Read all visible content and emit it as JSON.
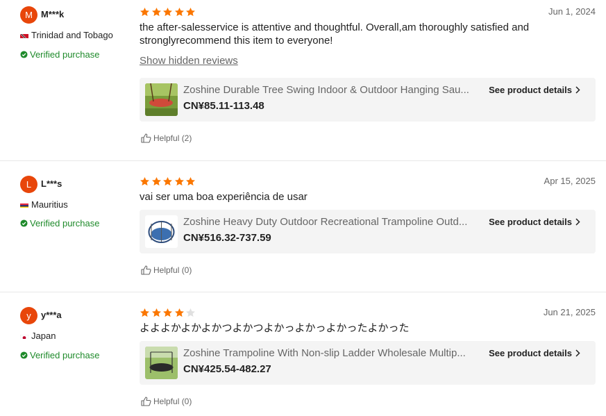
{
  "reviews": [
    {
      "avatar_letter": "M",
      "username": "M***k",
      "country": "Trinidad and Tobago",
      "verified_label": "Verified purchase",
      "rating": 5,
      "date": "Jun 1, 2024",
      "text": "the after-salesservice is attentive and thoughtful. Overall,am thoroughly satisfied and stronglyrecommend this item to everyone!",
      "show_hidden_label": "Show hidden reviews",
      "product": {
        "title": "Zoshine Durable Tree Swing Indoor & Outdoor Hanging Sau...",
        "price": "CN¥85.11-113.48",
        "details_label": "See product details"
      },
      "helpful_label": "Helpful (2)"
    },
    {
      "avatar_letter": "L",
      "username": "L***s",
      "country": "Mauritius",
      "verified_label": "Verified purchase",
      "rating": 5,
      "date": "Apr 15, 2025",
      "text": "vai ser uma boa experiência de usar",
      "product": {
        "title": "Zoshine Heavy Duty Outdoor Recreational Trampoline Outd...",
        "price": "CN¥516.32-737.59",
        "details_label": "See product details"
      },
      "helpful_label": "Helpful (0)"
    },
    {
      "avatar_letter": "y",
      "username": "y***a",
      "country": "Japan",
      "verified_label": "Verified purchase",
      "rating": 4,
      "date": "Jun 21, 2025",
      "text": "よよよかよかよかつよかつよかっよかっよかったよかった",
      "product": {
        "title": "Zoshine Trampoline With Non-slip Ladder Wholesale Multip...",
        "price": "CN¥425.54-482.27",
        "details_label": "See product details"
      },
      "helpful_label": "Helpful (0)"
    }
  ],
  "colors": {
    "accent": "#e8460a",
    "star": "#fb7701",
    "star_empty": "#e0e0e0",
    "verified": "#1e8a2a"
  }
}
